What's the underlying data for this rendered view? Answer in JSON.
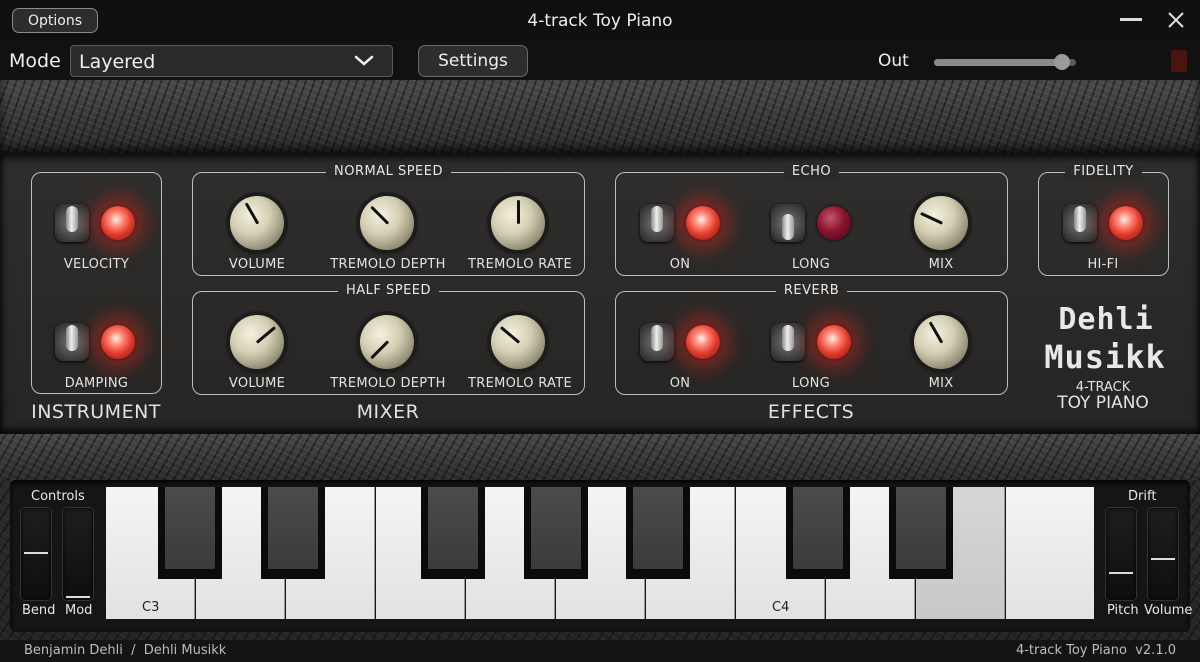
{
  "window": {
    "title": "4-track Toy Piano",
    "options_label": "Options"
  },
  "toolbar": {
    "mode_label": "Mode",
    "mode_value": "Layered",
    "settings_label": "Settings",
    "out_label": "Out",
    "out_level": 0.9
  },
  "instrument": {
    "section": "INSTRUMENT",
    "velocity_label": "VELOCITY",
    "damping_label": "DAMPING"
  },
  "mixer": {
    "section": "MIXER",
    "normal_title": "NORMAL SPEED",
    "half_title": "HALF SPEED",
    "volume_label": "VOLUME",
    "tremolo_depth_label": "TREMOLO DEPTH",
    "tremolo_rate_label": "TREMOLO RATE"
  },
  "effects": {
    "section": "EFFECTS",
    "echo_title": "ECHO",
    "reverb_title": "REVERB",
    "on_label": "ON",
    "long_label": "LONG",
    "mix_label": "MIX"
  },
  "fidelity": {
    "title": "FIDELITY",
    "hifi_label": "HI-FI"
  },
  "logo": {
    "line1": "Dehli",
    "line2": "Musikk",
    "line3": "4-TRACK",
    "line4": "TOY PIANO"
  },
  "controls": {
    "left_title": "Controls",
    "bend_label": "Bend",
    "mod_label": "Mod",
    "right_title": "Drift",
    "pitch_label": "Pitch",
    "volume_label": "Volume"
  },
  "keyboard": {
    "c3_label": "C3",
    "c4_label": "C4"
  },
  "footer": {
    "left": "Benjamin Dehli  /  Dehli Musikk",
    "right": "4-track Toy Piano  v2.1.0"
  }
}
